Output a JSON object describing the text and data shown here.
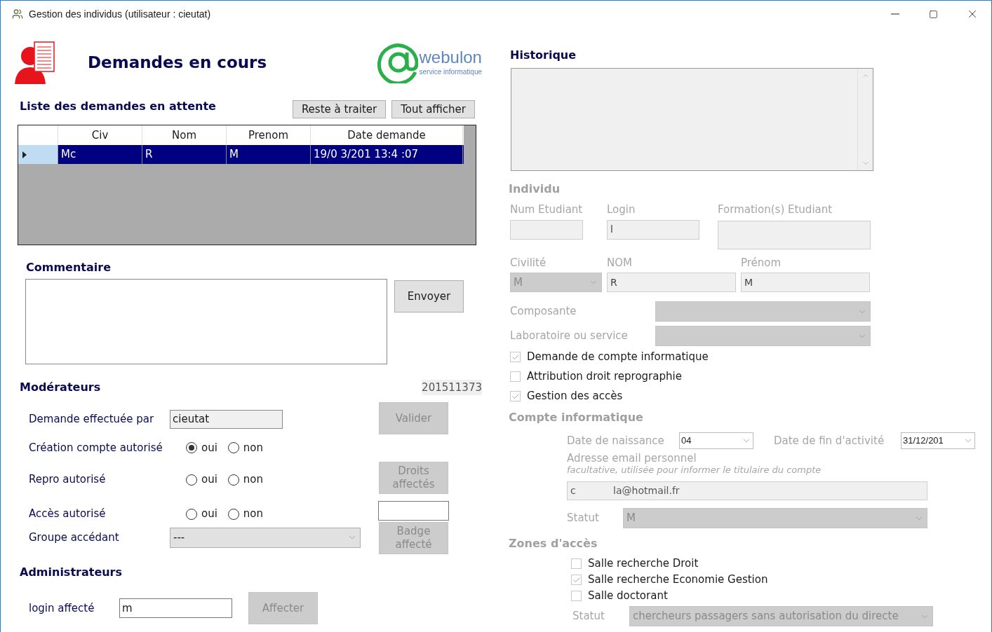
{
  "window": {
    "title": "Gestion des individus (utilisateur : cieutat)"
  },
  "header": {
    "title": "Demandes en cours",
    "logo_text": "webulon",
    "logo_subtext": "service informatique"
  },
  "pending": {
    "title": "Liste des demandes en attente",
    "buttons": [
      {
        "label": "Reste à traiter",
        "disabled": false
      },
      {
        "label": "Tout afficher",
        "disabled": false
      }
    ],
    "table": {
      "columns": [
        "Civ",
        "Nom",
        "Prenom",
        "Date demande"
      ],
      "rows": [
        {
          "selected": true,
          "cells": [
            "Mc",
            "R",
            "M",
            "19/0 3/201 13:4 :07"
          ]
        }
      ]
    }
  },
  "comment": {
    "label": "Commentaire",
    "send_button": {
      "label": "Envoyer",
      "disabled": false
    }
  },
  "moderators": {
    "title": "Modérateurs",
    "request_id": "201511373",
    "requested_by": {
      "label": "Demande effectuée par",
      "value": "cieutat"
    },
    "authorizations": [
      {
        "label": "Création compte autorisé",
        "options": [
          {
            "label": "oui",
            "selected": true
          },
          {
            "label": "non",
            "selected": false
          }
        ]
      },
      {
        "label": "Repro autorisé",
        "options": [
          {
            "label": "oui",
            "selected": false
          },
          {
            "label": "non",
            "selected": false
          }
        ]
      },
      {
        "label": "Accès autorisé",
        "options": [
          {
            "label": "oui",
            "selected": false
          },
          {
            "label": "non",
            "selected": false
          }
        ]
      }
    ],
    "validate_button": {
      "label": "Valider",
      "disabled": true
    },
    "rights_button": {
      "label": "Droits affectés",
      "disabled": true
    },
    "badge_button": {
      "label": "Badge affecté",
      "disabled": true
    },
    "access_group": {
      "label": "Groupe accédant",
      "value": "---"
    }
  },
  "administrators": {
    "title": "Administrateurs",
    "login": {
      "label": "login affecté",
      "value": "m"
    },
    "assign_button": {
      "label": "Affecter",
      "disabled": true
    }
  },
  "history": {
    "title": "Historique"
  },
  "individual": {
    "title": "Individu",
    "student_number": {
      "label": "Num Etudiant"
    },
    "login": {
      "label": "Login",
      "value": "l"
    },
    "training": {
      "label": "Formation(s) Etudiant"
    },
    "civility": {
      "label": "Civilité",
      "value": "M"
    },
    "last_name": {
      "label": "NOM",
      "value": "R"
    },
    "first_name": {
      "label": "Prénom",
      "value": "M"
    },
    "component": {
      "label": "Composante"
    },
    "lab": {
      "label": "Laboratoire ou service"
    },
    "checks": [
      {
        "label": "Demande de compte informatique",
        "checked": true
      },
      {
        "label": "Attribution droit reprographie",
        "checked": false
      },
      {
        "label": "Gestion des accès",
        "checked": true
      }
    ]
  },
  "account": {
    "title": "Compte informatique",
    "birth_date": {
      "label": "Date de naissance",
      "value": "04"
    },
    "end_date": {
      "label": "Date de fin d'activité",
      "value": "31/12/201"
    },
    "email": {
      "label": "Adresse email personnel",
      "hint": "facultative, utilisée pour informer le titulaire du compte",
      "value": "c            la@hotmail.fr"
    },
    "status": {
      "label": "Statut",
      "value": "M"
    }
  },
  "zones": {
    "title": "Zones d'accès",
    "items": [
      {
        "label": "Salle recherche Droit",
        "checked": false
      },
      {
        "label": "Salle recherche Economie Gestion",
        "checked": true
      },
      {
        "label": "Salle doctorant",
        "checked": false
      }
    ],
    "status": {
      "label": "Statut",
      "value": "chercheurs passagers sans autorisation du directe"
    }
  }
}
